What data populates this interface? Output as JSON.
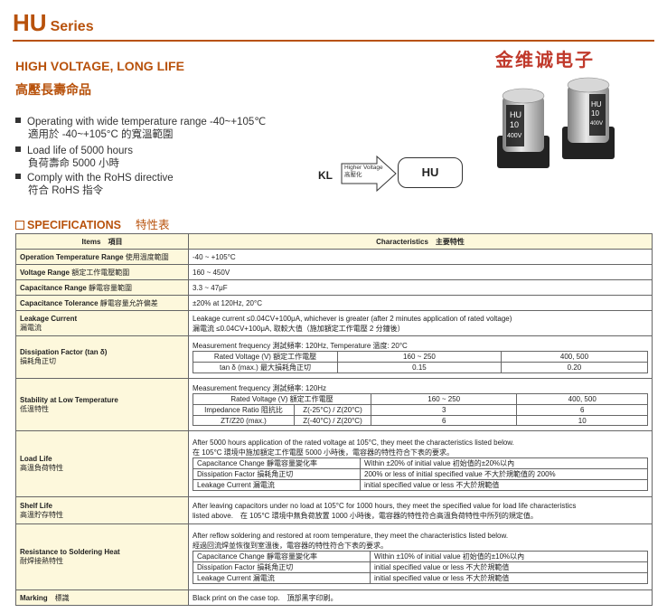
{
  "header": {
    "series_code": "HU",
    "series_word": "Series",
    "brand": "金维诚电子"
  },
  "headline": {
    "en": "HIGH VOLTAGE, LONG LIFE",
    "zh": "高壓長壽命品"
  },
  "features": [
    {
      "en": "Operating with wide temperature range -40~+105℃",
      "zh": "適用於 -40~+105°C 的寬溫範圍"
    },
    {
      "en": "Load life of 5000 hours",
      "zh": "負荷壽命 5000 小時"
    },
    {
      "en": "Comply with the RoHS directive",
      "zh": "符合 RoHS 指令"
    }
  ],
  "diagram": {
    "from": "KL",
    "arrow_line1": "Higher Voltage",
    "arrow_line2": "高壓化",
    "to": "HU"
  },
  "capacitors": [
    {
      "l1": "HU",
      "l2": "10",
      "l3": "400V"
    },
    {
      "l1": "HU",
      "l2": "10",
      "l3": "400V"
    }
  ],
  "spec": {
    "title": "SPECIFICATIONS",
    "zh": "特性表"
  },
  "table": {
    "head_items": "Items　項目",
    "head_char": "Characteristics　主要特性",
    "op_temp": {
      "en": "Operation Temperature Range",
      "zh": "使用溫度範圍",
      "val": "-40 ~ +105°C"
    },
    "voltage": {
      "en": "Voltage Range",
      "zh": "額定工作電壓範圍",
      "val": "160 ~ 450V"
    },
    "capacitance": {
      "en": "Capacitance Range",
      "zh": "靜電容量範圍",
      "val": "3.3 ~ 47μF"
    },
    "tolerance": {
      "en": "Capacitance Tolerance",
      "zh": "靜電容量允許偏差",
      "val": "±20% at 120Hz, 20°C"
    },
    "leakage": {
      "en": "Leakage Current",
      "zh": "漏電流",
      "l1": "Leakage current ≤0.04CV+100μA, whichever is greater (after 2 minutes application of rated voltage)",
      "l2": "漏電流 ≤0.04CV+100μA, 取較大值（施加額定工作電壓 2 分鐘後）"
    },
    "df": {
      "en": "Dissipation Factor (tan δ)",
      "zh": "損耗角正切",
      "meas": "Measurement frequency 測試頻率: 120Hz, Temperature 溫度: 20°C",
      "r1c1": "Rated Voltage (V) 額定工作電壓",
      "r1c2": "160 ~ 250",
      "r1c3": "400, 500",
      "r2c1": "tan δ (max.) 最大損耗角正切",
      "r2c2": "0.15",
      "r2c3": "0.20"
    },
    "stab": {
      "en": "Stability at Low Temperature",
      "zh": "低溫特性",
      "meas": "Measurement frequency 測試頻率: 120Hz",
      "rv": "Rated Voltage (V) 額定工作電壓",
      "rv2": "160 ~ 250",
      "rv3": "400, 500",
      "imp1": "Impedance Ratio 阻抗比",
      "imp2": "ZT/Z20 (max.)",
      "z1": "Z(-25°C) / Z(20°C)",
      "z1a": "3",
      "z1b": "6",
      "z2": "Z(-40°C) / Z(20°C)",
      "z2a": "6",
      "z2b": "10"
    },
    "load": {
      "en": "Load Life",
      "zh": "高溫負荷特性",
      "l1": "After 5000 hours application of the rated voltage at 105°C, they meet the characteristics listed below.",
      "l2": "在 105°C 環境中施加額定工作電壓 5000 小時後，電容器的特性符合下表的要求。",
      "a1": "Capacitance Change 靜電容量變化率",
      "b1": "Within ±20% of initial value 初始值的±20%以內",
      "a2": "Dissipation Factor 損耗角正切",
      "b2": "200% or less of initial specified value 不大於規範值的 200%",
      "a3": "Leakage Current 漏電流",
      "b3": "initial specified value or less 不大於規範值"
    },
    "shelf": {
      "en": "Shelf Life",
      "zh": "高溫貯存特性",
      "l1": "After leaving capacitors under no load at 105°C for 1000 hours, they meet the specified value for load life characteristics",
      "l2": "listed above.　在 105°C 環境中無負荷放置 1000 小時後，電容器的特性符合高溫負荷特性中所列的規定值。"
    },
    "solder": {
      "en": "Resistance to Soldering Heat",
      "zh": "耐焊接熱特性",
      "l1": "After reflow soldering and restored at room temperature, they meet the characteristics listed below.",
      "l2": "經過回流焊並恢復到室溫後，電容器的特性符合下表的要求。",
      "a1": "Capacitance Change 靜電容量變化率",
      "b1": "Within ±10% of initial value 初始值的±10%以內",
      "a2": "Dissipation Factor 損耗角正切",
      "b2": "initial specified value or less 不大於規範值",
      "a3": "Leakage Current 漏電流",
      "b3": "initial specified value or less 不大於規範值"
    },
    "marking": {
      "en": "Marking",
      "zh": "標識",
      "val": "Black print on the case top.　頂部黑字印刷。"
    }
  }
}
